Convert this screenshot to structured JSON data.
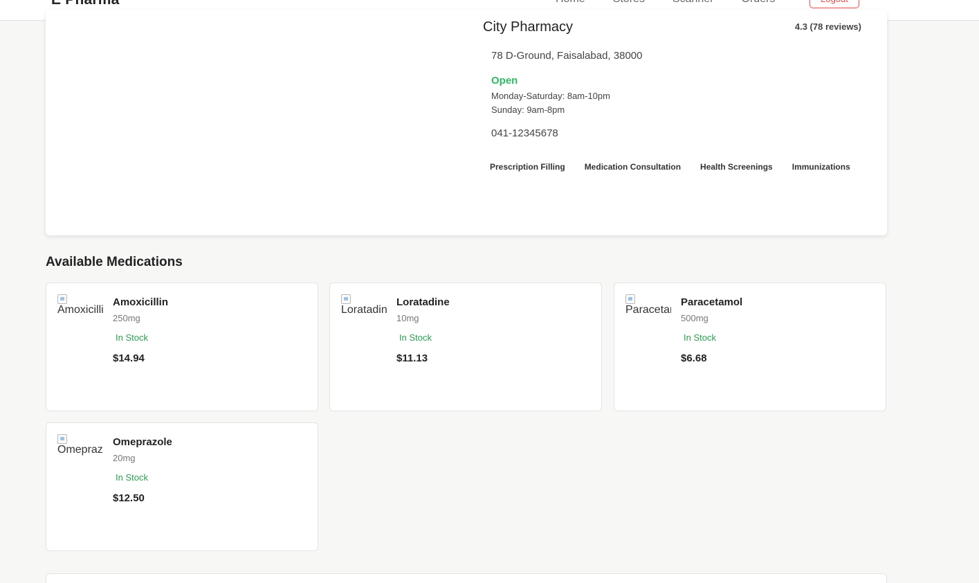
{
  "nav": {
    "brand": "E Pharma",
    "links": [
      "Home",
      "Stores",
      "Scanner",
      "Orders"
    ],
    "logout_label": "Logout"
  },
  "store": {
    "name": "City Pharmacy",
    "rating": "4.3 (78 reviews)",
    "address": "78 D-Ground, Faisalabad, 38000",
    "status": "Open",
    "hours": [
      "Monday-Saturday: 8am-10pm",
      "Sunday: 9am-8pm"
    ],
    "phone": "041-12345678",
    "services": [
      "Prescription Filling",
      "Medication Consultation",
      "Health Screenings",
      "Immunizations"
    ]
  },
  "medications_section": {
    "title": "Available Medications",
    "items": [
      {
        "alt": "Amoxicillin",
        "name": "Amoxicillin",
        "dose": "250mg",
        "stock": "In Stock",
        "price": "$14.94"
      },
      {
        "alt": "Loratadine",
        "name": "Loratadine",
        "dose": "10mg",
        "stock": "In Stock",
        "price": "$11.13"
      },
      {
        "alt": "Paracetamol",
        "name": "Paracetamol",
        "dose": "500mg",
        "stock": "In Stock",
        "price": "$6.68"
      },
      {
        "alt": "Omeprazole",
        "name": "Omeprazole",
        "dose": "20mg",
        "stock": "In Stock",
        "price": "$12.50"
      }
    ]
  },
  "colors": {
    "open_status": "#2fb765",
    "in_stock": "#2a9a50",
    "logout": "#e24b4b"
  }
}
